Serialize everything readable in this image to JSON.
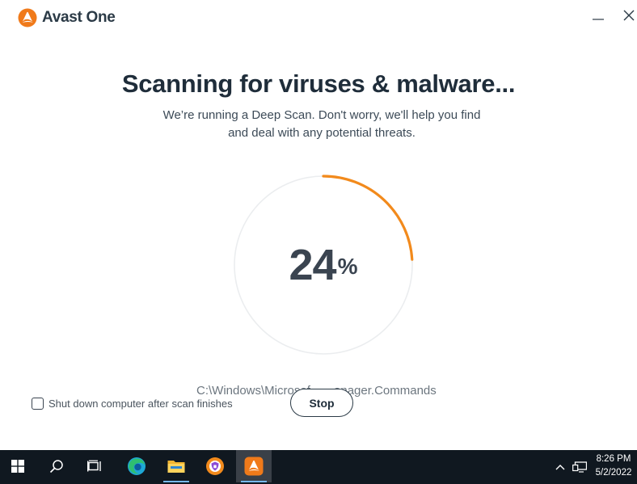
{
  "app": {
    "name": "Avast One",
    "brand_color": "#f07a1a"
  },
  "scan": {
    "title": "Scanning for viruses & malware...",
    "subtitle_line1": "We’re running a Deep Scan. Don't worry, we'll help you find",
    "subtitle_line2": "and deal with any potential threats.",
    "percent_value": "24",
    "percent_sign": "%",
    "progress_fraction": 0.24,
    "current_path": "C:\\Windows\\Microsof    ...anager.Commands",
    "shutdown_label": "Shut down computer after scan finishes",
    "shutdown_checked": false,
    "stop_label": "Stop"
  },
  "window_controls": {
    "minimize_icon": "minimize-icon",
    "close_icon": "close-icon"
  },
  "taskbar": {
    "items": [
      "windows-start-icon",
      "search-icon",
      "task-view-icon",
      "edge-icon",
      "file-explorer-icon",
      "avast-secure-browser-icon",
      "avast-one-icon"
    ],
    "active_item": "avast-one-icon",
    "time": "8:26 PM",
    "date": "5/2/2022"
  }
}
